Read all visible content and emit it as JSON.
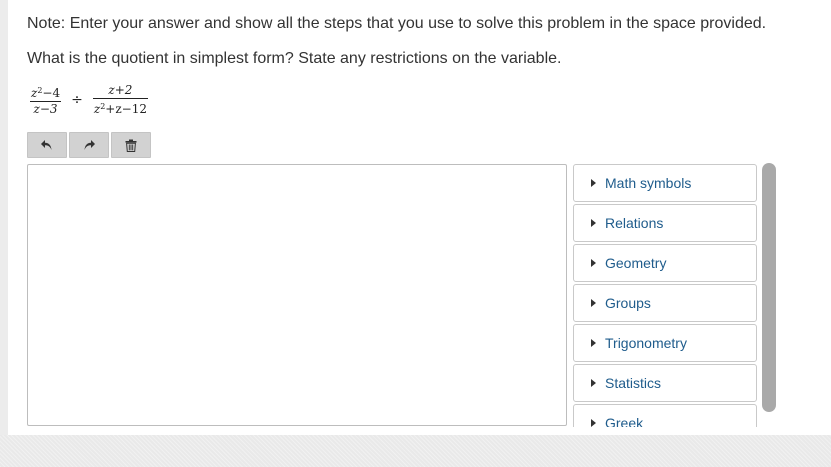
{
  "note": "Note: Enter your answer and show all the steps that you use to solve this problem in the space provided.",
  "question": "What is the quotient in simplest form? State any restrictions on the variable.",
  "expression": {
    "frac1": {
      "numerator_var": "z",
      "numerator_exp": "2",
      "numerator_rest": "−4",
      "denominator": "z−3"
    },
    "operator": "÷",
    "frac2": {
      "numerator": "z+2",
      "denominator_var": "z",
      "denominator_exp": "2",
      "denominator_rest": "+z−12"
    }
  },
  "toolbar": {
    "undo_icon": "undo-arrow-icon",
    "redo_icon": "redo-arrow-icon",
    "delete_icon": "trash-icon"
  },
  "editor": {
    "value": ""
  },
  "palette": {
    "items": [
      {
        "label": "Math symbols"
      },
      {
        "label": "Relations"
      },
      {
        "label": "Geometry"
      },
      {
        "label": "Groups"
      },
      {
        "label": "Trigonometry"
      },
      {
        "label": "Statistics"
      },
      {
        "label": "Greek"
      }
    ]
  },
  "colors": {
    "text": "#333333",
    "link": "#1f5c8c",
    "button_bg": "#d2d2d2",
    "scrollbar": "#a9a9a9"
  }
}
